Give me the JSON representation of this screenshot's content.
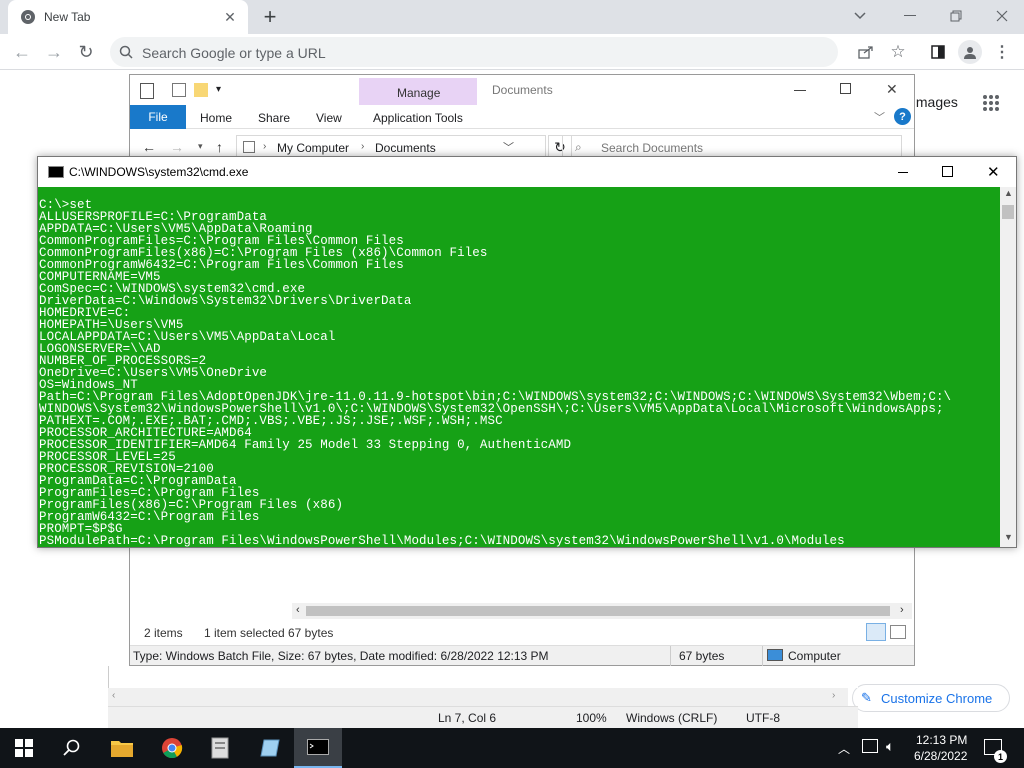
{
  "chrome": {
    "tab_title": "New Tab",
    "new_tab_symbol": "+",
    "omnibox_placeholder": "Search Google or type a URL",
    "images_link": "Images",
    "customize_button": "Customize Chrome"
  },
  "notepad": {
    "position": "Ln 7, Col 6",
    "zoom": "100%",
    "line_ending": "Windows (CRLF)",
    "encoding": "UTF-8"
  },
  "explorer": {
    "ribbon_context_group": "Manage",
    "window_title": "Documents",
    "tabs": [
      "File",
      "Home",
      "Share",
      "View",
      "Application Tools"
    ],
    "breadcrumb": [
      "My Computer",
      "Documents"
    ],
    "search_placeholder": "Search Documents",
    "items_count": "2 items",
    "selected_info": "1 item selected",
    "selected_size": "67 bytes",
    "details_text": "Type: Windows Batch File, Size: 67 bytes, Date modified: 6/28/2022 12:13 PM",
    "details_size": "67 bytes",
    "details_location": "Computer"
  },
  "cmd": {
    "title": "C:\\WINDOWS\\system32\\cmd.exe",
    "lines": [
      "C:\\>set",
      "ALLUSERSPROFILE=C:\\ProgramData",
      "APPDATA=C:\\Users\\VM5\\AppData\\Roaming",
      "CommonProgramFiles=C:\\Program Files\\Common Files",
      "CommonProgramFiles(x86)=C:\\Program Files (x86)\\Common Files",
      "CommonProgramW6432=C:\\Program Files\\Common Files",
      "COMPUTERNAME=VM5",
      "ComSpec=C:\\WINDOWS\\system32\\cmd.exe",
      "DriverData=C:\\Windows\\System32\\Drivers\\DriverData",
      "HOMEDRIVE=C:",
      "HOMEPATH=\\Users\\VM5",
      "LOCALAPPDATA=C:\\Users\\VM5\\AppData\\Local",
      "LOGONSERVER=\\\\AD",
      "NUMBER_OF_PROCESSORS=2",
      "OneDrive=C:\\Users\\VM5\\OneDrive",
      "OS=Windows_NT",
      "Path=C:\\Program Files\\AdoptOpenJDK\\jre-11.0.11.9-hotspot\\bin;C:\\WINDOWS\\system32;C:\\WINDOWS;C:\\WINDOWS\\System32\\Wbem;C:\\",
      "WINDOWS\\System32\\WindowsPowerShell\\v1.0\\;C:\\WINDOWS\\System32\\OpenSSH\\;C:\\Users\\VM5\\AppData\\Local\\Microsoft\\WindowsApps;",
      "PATHEXT=.COM;.EXE;.BAT;.CMD;.VBS;.VBE;.JS;.JSE;.WSF;.WSH;.MSC",
      "PROCESSOR_ARCHITECTURE=AMD64",
      "PROCESSOR_IDENTIFIER=AMD64 Family 25 Model 33 Stepping 0, AuthenticAMD",
      "PROCESSOR_LEVEL=25",
      "PROCESSOR_REVISION=2100",
      "ProgramData=C:\\ProgramData",
      "ProgramFiles=C:\\Program Files",
      "ProgramFiles(x86)=C:\\Program Files (x86)",
      "ProgramW6432=C:\\Program Files",
      "PROMPT=$P$G",
      "PSModulePath=C:\\Program Files\\WindowsPowerShell\\Modules;C:\\WINDOWS\\system32\\WindowsPowerShell\\v1.0\\Modules"
    ]
  },
  "taskbar": {
    "time": "12:13 PM",
    "date": "6/28/2022",
    "notification_count": "1"
  }
}
